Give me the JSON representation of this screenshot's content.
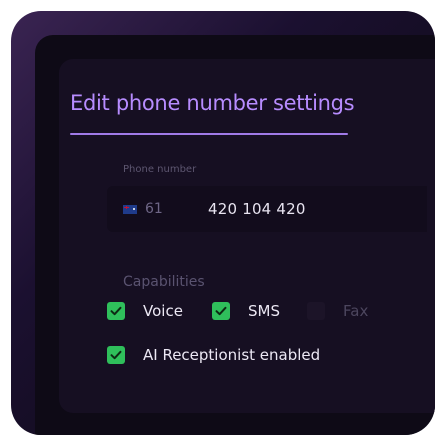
{
  "dialog": {
    "title": "Edit phone number settings"
  },
  "phone": {
    "label": "Phone number",
    "country_icon": "australia-flag-icon",
    "dial_code": "61",
    "value": "420 104 420"
  },
  "capabilities": {
    "heading": "Capabilities",
    "items": [
      {
        "label": "Voice",
        "checked": true
      },
      {
        "label": "SMS",
        "checked": true
      },
      {
        "label": "Fax",
        "checked": false
      },
      {
        "label": "AI Receptionist enabled",
        "checked": true
      }
    ]
  },
  "colors": {
    "accent": "#b78cff",
    "check_green": "#2fbf5b",
    "background": "#160f22"
  }
}
